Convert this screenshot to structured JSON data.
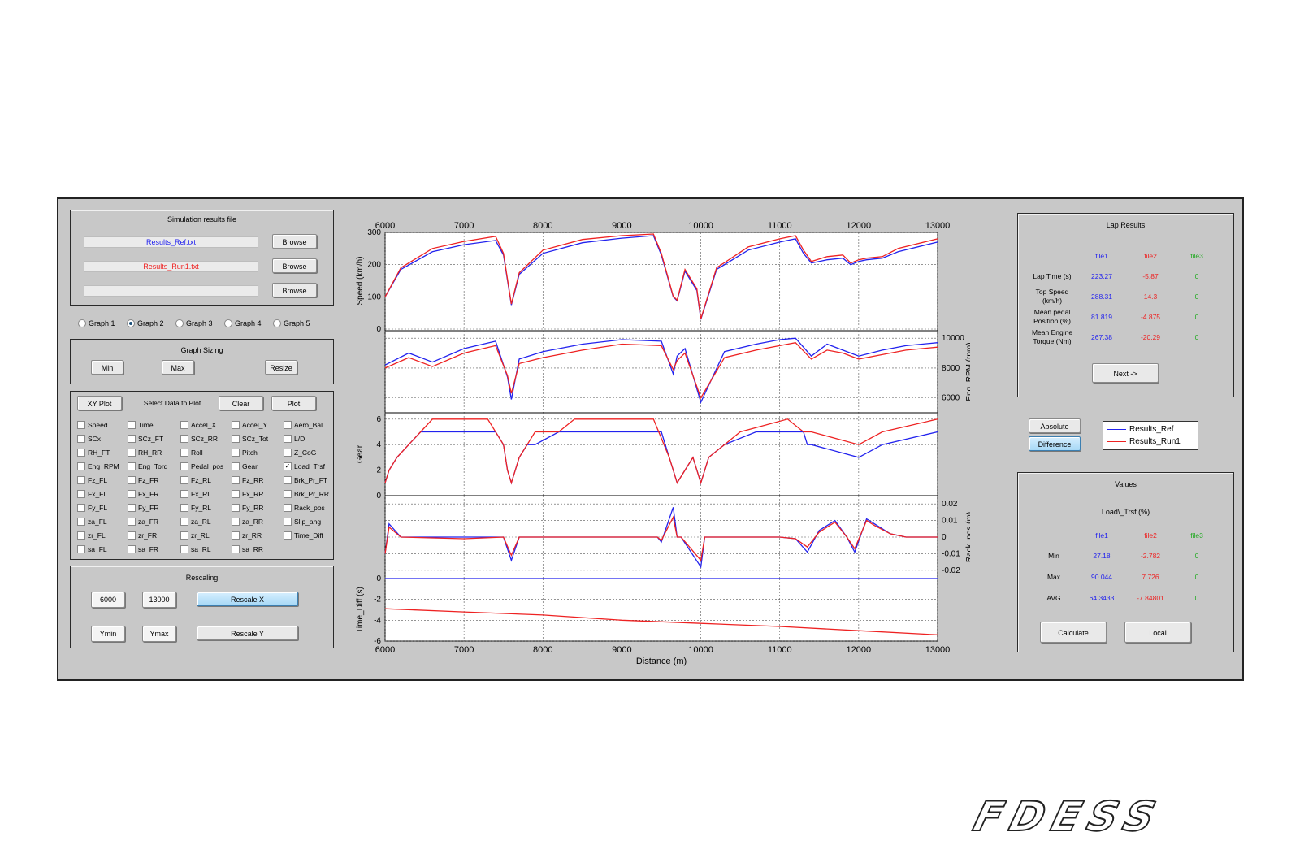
{
  "file_panel": {
    "title": "Simulation results file",
    "files": [
      {
        "value": "Results_Ref.txt",
        "color": "#2222ee"
      },
      {
        "value": "Results_Run1.txt",
        "color": "#ee2222"
      },
      {
        "value": "",
        "color": "#000000"
      }
    ],
    "browse_label": "Browse"
  },
  "graph_radios": [
    {
      "label": "Graph 1",
      "selected": false
    },
    {
      "label": "Graph 2",
      "selected": true
    },
    {
      "label": "Graph 3",
      "selected": false
    },
    {
      "label": "Graph 4",
      "selected": false
    },
    {
      "label": "Graph 5",
      "selected": false
    }
  ],
  "sizing": {
    "title": "Graph Sizing",
    "min": "Min",
    "max": "Max",
    "resize": "Resize"
  },
  "select": {
    "xy_plot": "XY Plot",
    "title": "Select Data to Plot",
    "clear": "Clear",
    "plot": "Plot",
    "checkbox_rows": [
      [
        "Speed",
        "Time",
        "Accel_X",
        "Accel_Y",
        "Aero_Bal"
      ],
      [
        "SCx",
        "SCz_FT",
        "SCz_RR",
        "SCz_Tot",
        "L/D"
      ],
      [
        "RH_FT",
        "RH_RR",
        "Roll",
        "Pitch",
        "Z_CoG"
      ],
      [
        "Eng_RPM",
        "Eng_Torq",
        "Pedal_pos",
        "Gear",
        "Load_Trsf"
      ],
      [
        "Fz_FL",
        "Fz_FR",
        "Fz_RL",
        "Fz_RR",
        "Brk_Pr_FT"
      ],
      [
        "Fx_FL",
        "Fx_FR",
        "Fx_RL",
        "Fx_RR",
        "Brk_Pr_RR"
      ],
      [
        "Fy_FL",
        "Fy_FR",
        "Fy_RL",
        "Fy_RR",
        "Rack_pos"
      ],
      [
        "za_FL",
        "za_FR",
        "za_RL",
        "za_RR",
        "Slip_ang"
      ],
      [
        "zr_FL",
        "zr_FR",
        "zr_RL",
        "zr_RR",
        "Time_Diff"
      ],
      [
        "sa_FL",
        "sa_FR",
        "sa_RL",
        "sa_RR",
        ""
      ]
    ],
    "checked": [
      "Load_Trsf"
    ]
  },
  "rescaling": {
    "title": "Rescaling",
    "xmin": "6000",
    "xmax": "13000",
    "rescale_x": "Rescale X",
    "ymin": "Ymin",
    "ymax": "Ymax",
    "rescale_y": "Rescale Y"
  },
  "lap_results": {
    "title": "Lap Results",
    "headers": [
      "file1",
      "file2",
      "file3"
    ],
    "header_colors": [
      "#2222ee",
      "#ee2222",
      "#22aa22"
    ],
    "rows": [
      {
        "label": [
          "Lap Time (s)"
        ],
        "values": [
          "223.27",
          "-5.87",
          "0"
        ]
      },
      {
        "label": [
          "Top Speed",
          "(km/h)"
        ],
        "values": [
          "288.31",
          "14.3",
          "0"
        ]
      },
      {
        "label": [
          "Mean pedal",
          "Position (%)"
        ],
        "values": [
          "81.819",
          "-4.875",
          "0"
        ]
      },
      {
        "label": [
          "Mean Engine",
          "Torque (Nm)"
        ],
        "values": [
          "267.38",
          "-20.29",
          "0"
        ]
      }
    ],
    "next": "Next ->"
  },
  "mode": {
    "absolute": "Absolute",
    "difference": "Difference"
  },
  "legend": [
    {
      "name": "Results_Ref",
      "color": "#2222ee"
    },
    {
      "name": "Results_Run1",
      "color": "#ee2222"
    }
  ],
  "values_panel": {
    "title": "Values",
    "variable": "Load\\_Trsf (%)",
    "headers": [
      "file1",
      "file2",
      "file3"
    ],
    "rows": [
      {
        "label": "Min",
        "values": [
          "27.18",
          "-2.782",
          "0"
        ]
      },
      {
        "label": "Max",
        "values": [
          "90.044",
          "7.726",
          "0"
        ]
      },
      {
        "label": "AVG",
        "values": [
          "64.3433",
          "-7.84801",
          "0"
        ]
      }
    ],
    "calculate": "Calculate",
    "local": "Local"
  },
  "chart_data": {
    "type": "line",
    "xlabel": "Distance (m)",
    "xlim": [
      6000,
      13000
    ],
    "xticks": [
      "6000",
      "7000",
      "8000",
      "9000",
      "10000",
      "11000",
      "12000",
      "13000"
    ],
    "grid": true,
    "series_colors": {
      "Results_Ref": "#2222ee",
      "Results_Run1": "#ee2222"
    },
    "subplots": [
      {
        "ylabel": "Speed (km/h)",
        "ylim": [
          0,
          300
        ],
        "yticks": [
          "0",
          "100",
          "200",
          "300"
        ],
        "yaxis_side": "left",
        "series": [
          {
            "name": "Results_Ref",
            "x": [
              6000,
              6200,
              6600,
              7000,
              7400,
              7500,
              7600,
              7700,
              8000,
              8500,
              9000,
              9400,
              9500,
              9650,
              9700,
              9800,
              9950,
              10000,
              10200,
              10600,
              11000,
              11200,
              11300,
              11400,
              11600,
              11800,
              11900,
              12000,
              12100,
              12300,
              12500,
              13000
            ],
            "y": [
              100,
              185,
              240,
              262,
              275,
              230,
              75,
              170,
              235,
              268,
              282,
              290,
              230,
              100,
              88,
              180,
              120,
              30,
              185,
              245,
              270,
              280,
              235,
              205,
              215,
              220,
              200,
              210,
              215,
              220,
              240,
              270
            ]
          },
          {
            "name": "Results_Run1",
            "x": [
              6000,
              6200,
              6600,
              7000,
              7400,
              7500,
              7600,
              7700,
              8000,
              8500,
              9000,
              9400,
              9500,
              9650,
              9700,
              9800,
              9950,
              10000,
              10200,
              10600,
              11000,
              11200,
              11300,
              11400,
              11600,
              11800,
              11900,
              12000,
              12100,
              12300,
              12500,
              13000
            ],
            "y": [
              100,
              190,
              250,
              272,
              288,
              235,
              78,
              175,
              245,
              278,
              290,
              295,
              235,
              102,
              90,
              185,
              125,
              32,
              190,
              255,
              280,
              290,
              245,
              210,
              225,
              230,
              205,
              215,
              220,
              225,
              250,
              280
            ]
          }
        ]
      },
      {
        "ylabel": "Eng_RPM (rpm)",
        "ylim": [
          5000,
          10500
        ],
        "yticks": [
          "6000",
          "8000",
          "10000"
        ],
        "yaxis_side": "right",
        "series": [
          {
            "name": "Results_Ref",
            "x": [
              6000,
              6300,
              6600,
              7000,
              7400,
              7550,
              7600,
              7700,
              8000,
              8500,
              9000,
              9500,
              9650,
              9700,
              9800,
              10000,
              10300,
              10700,
              11000,
              11200,
              11400,
              11600,
              11800,
              12000,
              12300,
              12600,
              13000
            ],
            "y": [
              8200,
              9000,
              8400,
              9300,
              9800,
              7400,
              5900,
              8600,
              9100,
              9600,
              9900,
              9800,
              7600,
              8800,
              9300,
              5700,
              9100,
              9600,
              9900,
              10000,
              8800,
              9600,
              9200,
              8800,
              9200,
              9500,
              9700
            ]
          },
          {
            "name": "Results_Run1",
            "x": [
              6000,
              6300,
              6600,
              7000,
              7400,
              7550,
              7600,
              7700,
              8000,
              8500,
              9000,
              9500,
              9650,
              9700,
              9800,
              10000,
              10300,
              10700,
              11000,
              11200,
              11400,
              11600,
              11800,
              12000,
              12300,
              12600,
              13000
            ],
            "y": [
              8000,
              8700,
              8100,
              9000,
              9500,
              7500,
              6300,
              8300,
              8700,
              9200,
              9600,
              9500,
              7900,
              8500,
              9000,
              6000,
              8700,
              9200,
              9500,
              9700,
              8600,
              9200,
              9000,
              8600,
              8900,
              9200,
              9400
            ]
          }
        ]
      },
      {
        "ylabel": "Gear",
        "ylim": [
          0,
          6.5
        ],
        "yticks": [
          "0",
          "2",
          "4",
          "6"
        ],
        "yaxis_side": "left",
        "series": [
          {
            "name": "Results_Ref",
            "x": [
              6000,
              6050,
              6150,
              6300,
              6450,
              6700,
              7400,
              7500,
              7550,
              7600,
              7700,
              7800,
              7900,
              8200,
              8600,
              9500,
              9600,
              9650,
              9700,
              9800,
              9900,
              10000,
              10100,
              10300,
              10700,
              11300,
              11350,
              11400,
              12000,
              12300,
              13000
            ],
            "y": [
              1,
              2,
              3,
              4,
              5,
              5,
              5,
              4,
              2,
              1,
              3,
              4,
              4,
              5,
              5,
              5,
              3,
              2,
              1,
              2,
              3,
              1,
              3,
              4,
              5,
              5,
              4,
              4,
              3,
              4,
              5
            ]
          },
          {
            "name": "Results_Run1",
            "x": [
              6000,
              6050,
              6150,
              6300,
              6450,
              6600,
              7300,
              7500,
              7550,
              7600,
              7700,
              7800,
              7900,
              8200,
              8400,
              9400,
              9600,
              9650,
              9700,
              9800,
              9900,
              10000,
              10100,
              10300,
              10500,
              11100,
              11300,
              11400,
              12000,
              12300,
              13000
            ],
            "y": [
              1,
              2,
              3,
              4,
              5,
              6,
              6,
              4,
              2,
              1,
              3,
              4,
              5,
              5,
              6,
              6,
              3,
              2,
              1,
              2,
              3,
              1,
              3,
              4,
              5,
              6,
              5,
              5,
              4,
              5,
              6
            ]
          }
        ]
      },
      {
        "ylabel": "Rack_pos (m)",
        "ylim": [
          -0.025,
          0.025
        ],
        "yticks": [
          "-0.02",
          "-0.01",
          "0",
          "0.01",
          "0.02"
        ],
        "yaxis_side": "right",
        "series": [
          {
            "name": "Results_Ref",
            "x": [
              6000,
              6050,
              6200,
              7000,
              7500,
              7600,
              7700,
              8000,
              9000,
              9450,
              9500,
              9650,
              9700,
              9750,
              10000,
              10050,
              11000,
              11200,
              11350,
              11500,
              11700,
              11850,
              11950,
              12100,
              12200,
              12400,
              12600,
              13000
            ],
            "y": [
              -0.01,
              0.008,
              0,
              0,
              0,
              -0.014,
              0,
              0,
              0,
              0,
              -0.003,
              0.018,
              0,
              0,
              -0.018,
              0,
              0,
              -0.001,
              -0.009,
              0.004,
              0.01,
              0,
              -0.009,
              0.011,
              0.008,
              0.002,
              0,
              0
            ]
          },
          {
            "name": "Results_Run1",
            "x": [
              6000,
              6050,
              6200,
              7000,
              7500,
              7600,
              7700,
              8000,
              9000,
              9450,
              9500,
              9650,
              9700,
              9750,
              10000,
              10050,
              11000,
              11200,
              11350,
              11500,
              11700,
              11850,
              11950,
              12100,
              12200,
              12400,
              12600,
              13000
            ],
            "y": [
              -0.01,
              0.006,
              0,
              -0.001,
              0,
              -0.011,
              0,
              0,
              0,
              0,
              -0.002,
              0.012,
              0,
              0,
              -0.014,
              0,
              0,
              -0.001,
              -0.006,
              0.003,
              0.009,
              0,
              -0.007,
              0.01,
              0.007,
              0.002,
              0,
              0
            ]
          }
        ]
      },
      {
        "ylabel": "Time_Diff (s)",
        "ylim": [
          -6,
          0
        ],
        "yticks": [
          "-6",
          "-4",
          "-2",
          "0"
        ],
        "yaxis_side": "left",
        "series": [
          {
            "name": "Results_Ref",
            "x": [
              6000,
              13000
            ],
            "y": [
              0,
              0
            ]
          },
          {
            "name": "Results_Run1",
            "x": [
              6000,
              7000,
              8000,
              9000,
              10000,
              11000,
              12000,
              13000
            ],
            "y": [
              -2.9,
              -3.2,
              -3.5,
              -4.0,
              -4.3,
              -4.6,
              -5.0,
              -5.4
            ]
          }
        ]
      }
    ]
  },
  "logo": {
    "text": "FDESS"
  }
}
